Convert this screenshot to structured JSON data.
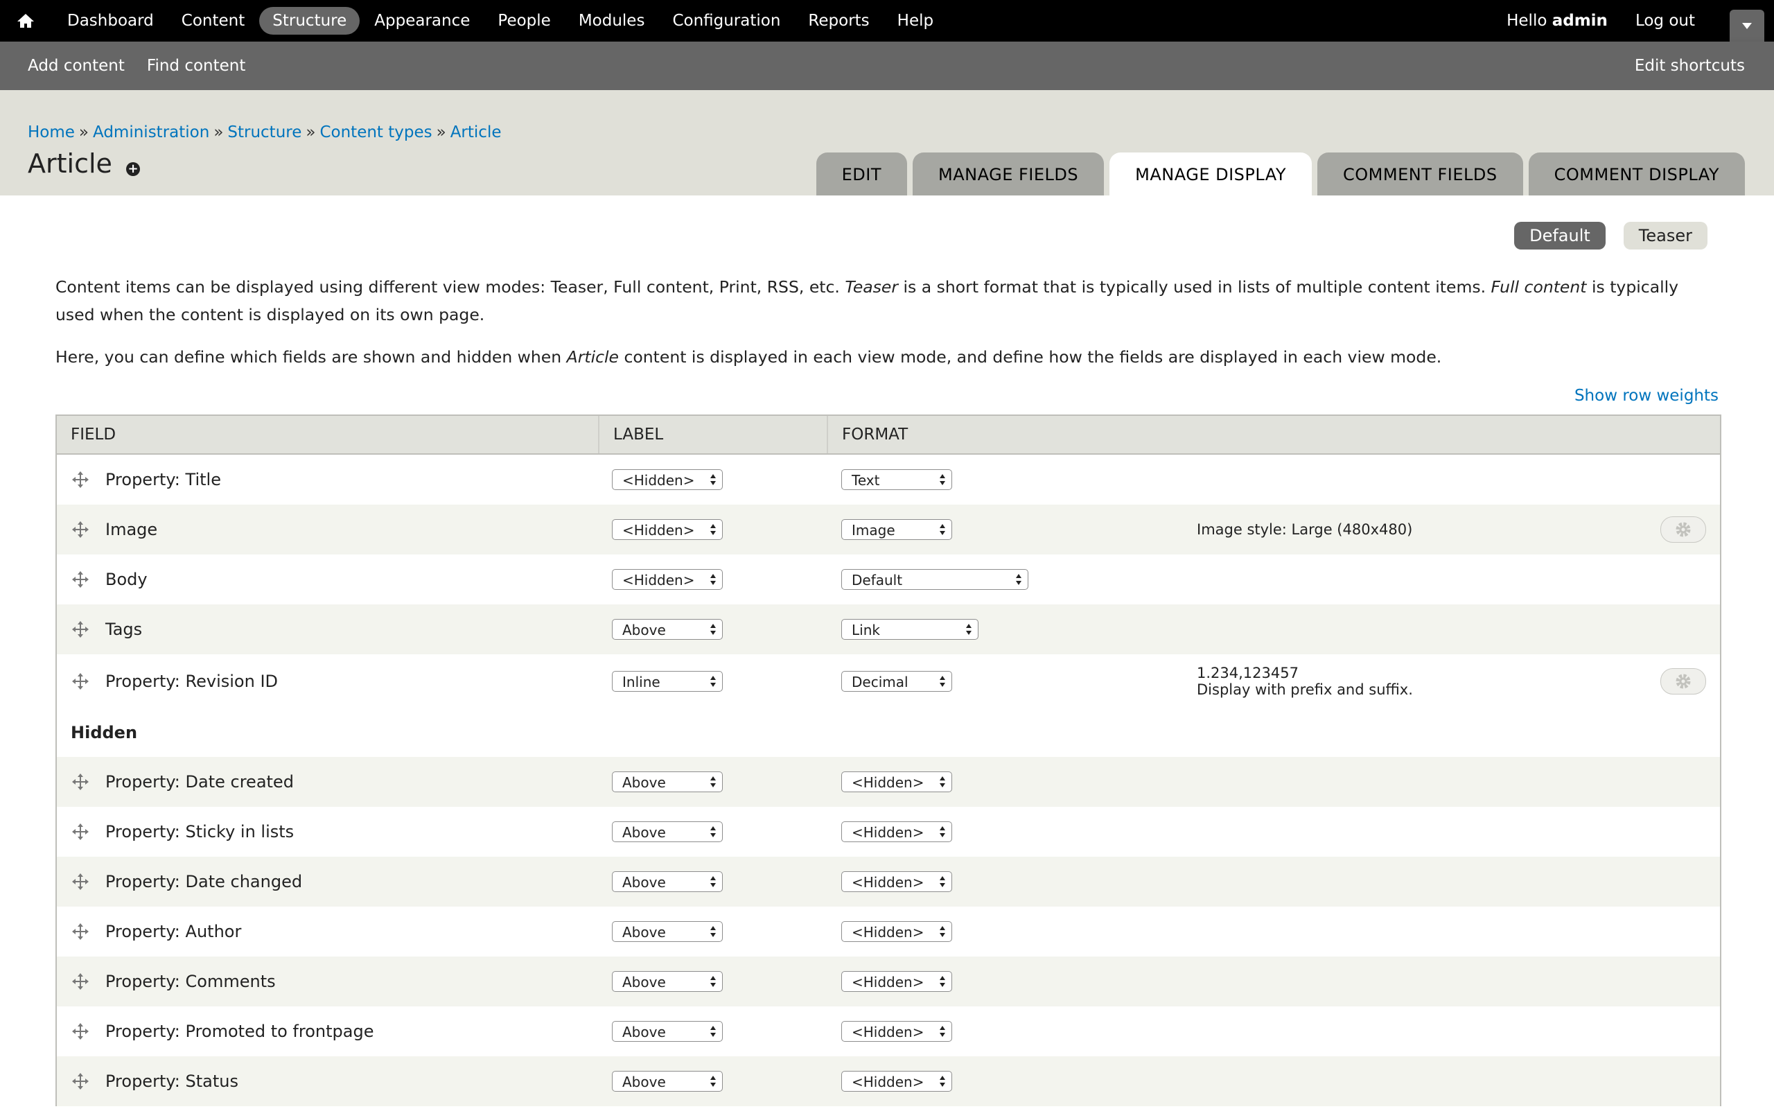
{
  "toolbar": {
    "menu": [
      {
        "label": "Dashboard"
      },
      {
        "label": "Content"
      },
      {
        "label": "Structure",
        "active": true
      },
      {
        "label": "Appearance"
      },
      {
        "label": "People"
      },
      {
        "label": "Modules"
      },
      {
        "label": "Configuration"
      },
      {
        "label": "Reports"
      },
      {
        "label": "Help"
      }
    ],
    "hello_prefix": "Hello ",
    "username": "admin",
    "logout": "Log out"
  },
  "shortcuts": {
    "items": [
      "Add content",
      "Find content"
    ],
    "edit": "Edit shortcuts"
  },
  "breadcrumb": {
    "items": [
      "Home",
      "Administration",
      "Structure",
      "Content types",
      "Article"
    ],
    "separator": "»"
  },
  "page": {
    "title": "Article",
    "add_shortcut_icon": "plus-circle-icon"
  },
  "tabs": [
    {
      "label": "Edit"
    },
    {
      "label": "Manage fields"
    },
    {
      "label": "Manage display",
      "active": true
    },
    {
      "label": "Comment fields"
    },
    {
      "label": "Comment display"
    }
  ],
  "view_modes": [
    {
      "label": "Default",
      "active": true
    },
    {
      "label": "Teaser"
    }
  ],
  "description": {
    "p1_a": "Content items can be displayed using different view modes: Teaser, Full content, Print, RSS, etc. ",
    "p1_em1": "Teaser",
    "p1_b": " is a short format that is typically used in lists of multiple content items. ",
    "p1_em2": "Full content",
    "p1_c": " is typically used when the content is displayed on its own page.",
    "p2_a": "Here, you can define which fields are shown and hidden when ",
    "p2_em": "Article",
    "p2_b": " content is displayed in each view mode, and define how the fields are displayed in each view mode."
  },
  "show_row_weights": "Show row weights",
  "table": {
    "headers": {
      "field": "Field",
      "label": "Label",
      "format": "Format"
    },
    "visible_rows": [
      {
        "field": "Property: Title",
        "label": "<Hidden>",
        "format": "Text",
        "summary": ""
      },
      {
        "field": "Image",
        "label": "<Hidden>",
        "format": "Image",
        "summary": "Image style: Large (480x480)"
      },
      {
        "field": "Body",
        "label": "<Hidden>",
        "format": "Default",
        "summary": ""
      },
      {
        "field": "Tags",
        "label": "Above",
        "format": "Link",
        "summary": ""
      },
      {
        "field": "Property: Revision ID",
        "label": "Inline",
        "format": "Decimal",
        "summary_line1": "1.234,123457",
        "summary_line2": "Display with prefix and suffix."
      }
    ],
    "hidden_region_title": "Hidden",
    "hidden_rows": [
      {
        "field": "Property: Date created",
        "label": "Above",
        "format": "<Hidden>"
      },
      {
        "field": "Property: Sticky in lists",
        "label": "Above",
        "format": "<Hidden>"
      },
      {
        "field": "Property: Date changed",
        "label": "Above",
        "format": "<Hidden>"
      },
      {
        "field": "Property: Author",
        "label": "Above",
        "format": "<Hidden>"
      },
      {
        "field": "Property: Comments",
        "label": "Above",
        "format": "<Hidden>"
      },
      {
        "field": "Property: Promoted to frontpage",
        "label": "Above",
        "format": "<Hidden>"
      },
      {
        "field": "Property: Status",
        "label": "Above",
        "format": "<Hidden>"
      }
    ]
  },
  "icons": {
    "home": "home-icon",
    "drag": "drag-handle-icon",
    "gear": "gear-icon",
    "toggle": "chevron-down-icon"
  },
  "colors": {
    "toolbar_bg": "#000000",
    "shortcut_bg": "#666666",
    "header_bg": "#e0e0d8",
    "link": "#0074bd",
    "tab_bg": "#a6a7a2"
  }
}
